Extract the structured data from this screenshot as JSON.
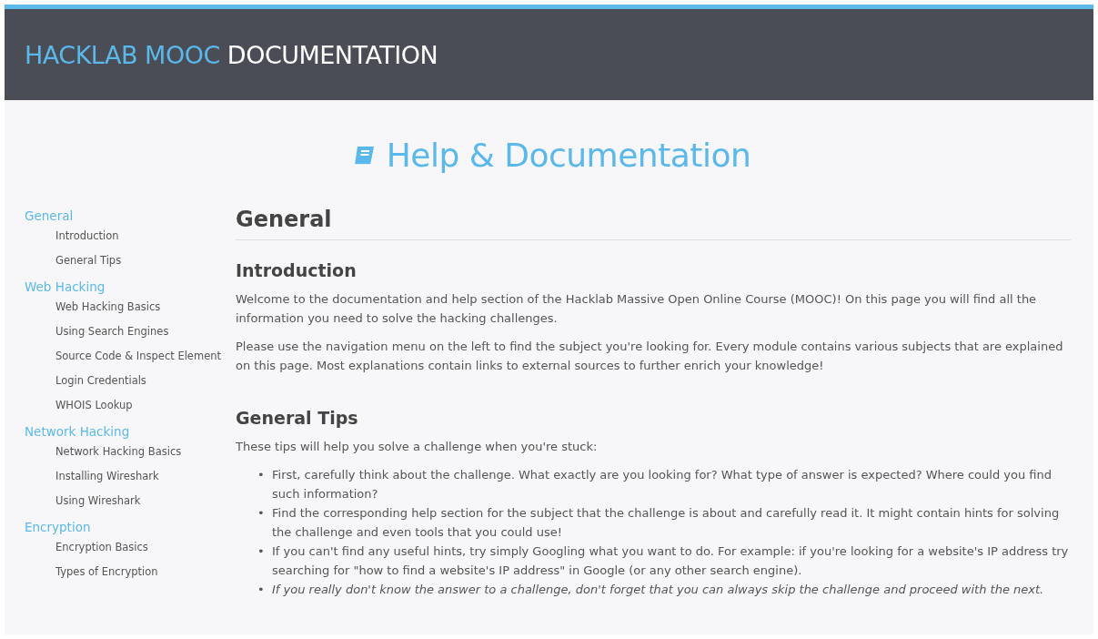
{
  "header": {
    "brand": "HACKLAB MOOC",
    "title": "DOCUMENTATION"
  },
  "page_title": "Help & Documentation",
  "sidebar": {
    "groups": [
      {
        "label": "General",
        "children": [
          {
            "label": "Introduction"
          },
          {
            "label": "General Tips"
          }
        ]
      },
      {
        "label": "Web Hacking",
        "children": [
          {
            "label": "Web Hacking Basics"
          },
          {
            "label": "Using Search Engines"
          },
          {
            "label": "Source Code & Inspect Element"
          },
          {
            "label": "Login Credentials"
          },
          {
            "label": "WHOIS Lookup"
          }
        ]
      },
      {
        "label": "Network Hacking",
        "children": [
          {
            "label": "Network Hacking Basics"
          },
          {
            "label": "Installing Wireshark"
          },
          {
            "label": "Using Wireshark"
          }
        ]
      },
      {
        "label": "Encryption",
        "children": [
          {
            "label": "Encryption Basics"
          },
          {
            "label": "Types of Encryption"
          }
        ]
      }
    ]
  },
  "content": {
    "heading": "General",
    "sections": [
      {
        "title": "Introduction",
        "paragraphs": [
          "Welcome to the documentation and help section of the Hacklab Massive Open Online Course (MOOC)! On this page you will find all the information you need to solve the hacking challenges.",
          "Please use the navigation menu on the left to find the subject you're looking for. Every module contains various subjects that are explained on this page. Most explanations contain links to external sources to further enrich your knowledge!"
        ]
      },
      {
        "title": "General Tips",
        "paragraphs": [
          "These tips will help you solve a challenge when you're stuck:"
        ],
        "tips": [
          {
            "kind": "normal",
            "marker": "•",
            "text": "First, carefully think about the challenge. What exactly are you looking for? What type of answer is expected? Where could you find such information?"
          },
          {
            "kind": "normal",
            "marker": "•",
            "text": "Find the corresponding help section for the subject that the challenge is about and carefully read it. It might contain hints for solving the challenge and even tools that you could use!"
          },
          {
            "kind": "normal",
            "marker": "•",
            "text": "If you can't find any useful hints, try simply Googling what you want to do. For example: if you're looking for a website's IP address try searching for \"how to find a website's IP address\" in Google (or any other search engine)."
          },
          {
            "kind": "note",
            "marker": "•",
            "text": "If you really don't know the answer to a challenge, don't forget that you can always skip the challenge and proceed with the next."
          }
        ]
      }
    ]
  }
}
